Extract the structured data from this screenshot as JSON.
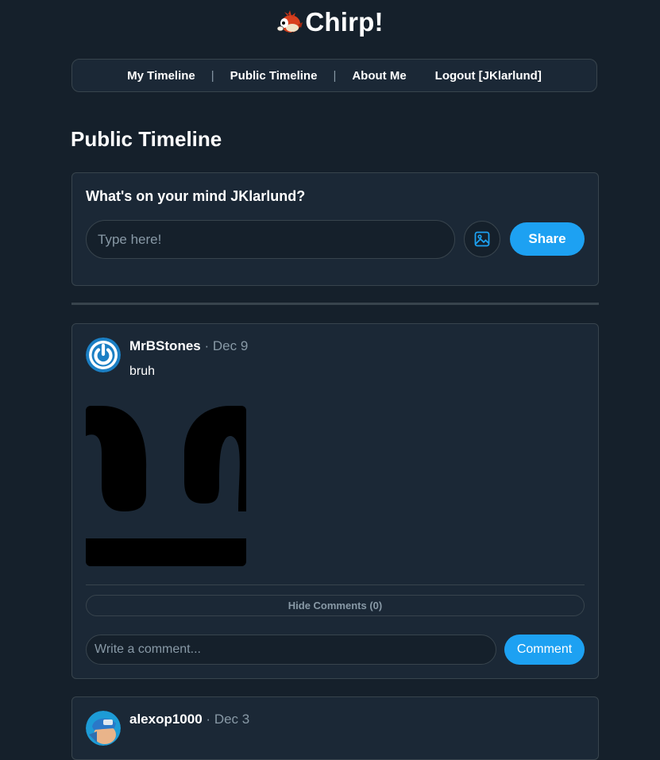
{
  "app": {
    "title": "Chirp!",
    "logo_icon": "red-bird-icon"
  },
  "nav": {
    "items": [
      {
        "label": "My Timeline"
      },
      {
        "label": "Public Timeline"
      },
      {
        "label": "About Me"
      },
      {
        "label": "Logout [JKlarlund]"
      }
    ],
    "separator": "|"
  },
  "page": {
    "title": "Public Timeline"
  },
  "composer": {
    "prompt": "What's on your mind JKlarlund?",
    "placeholder": "Type here!",
    "image_icon": "image-icon",
    "share_label": "Share"
  },
  "posts": [
    {
      "username": "MrBStones",
      "dot": "·",
      "date": "Dec 9",
      "text": "bruh",
      "avatar_icon": "power-icon",
      "has_image": true,
      "hide_comments_label": "Hide Comments (0)",
      "comment_placeholder": "Write a comment...",
      "comment_label": "Comment"
    },
    {
      "username": "alexop1000",
      "dot": "·",
      "date": "Dec 3",
      "avatar_icon": "soldier-avatar-icon"
    }
  ],
  "colors": {
    "background": "#15202b",
    "card": "#1b2836",
    "border": "#38444d",
    "accent": "#1da1f2",
    "muted": "#8899a6"
  }
}
